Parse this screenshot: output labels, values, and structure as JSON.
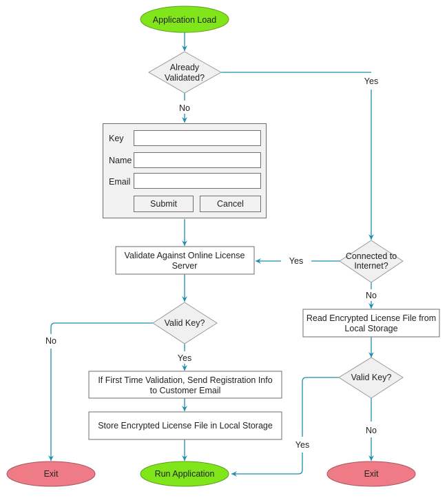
{
  "colors": {
    "connector": "#1b8db0",
    "start_fill": "#80e51a",
    "exit_fill": "#ee7b86",
    "decision_fill": "#f0f0f0",
    "box_stroke": "#6e6e6e"
  },
  "nodes": {
    "start": "Application Load",
    "already_validated": [
      "Already",
      "Validated?"
    ],
    "validate_online": [
      "Validate Against Online License",
      "Server"
    ],
    "valid_key_left": "Valid Key?",
    "send_registration": [
      "If First Time Validation, Send Registration Info",
      "to Customer Email"
    ],
    "store_license": "Store Encrypted License File in Local Storage",
    "exit_left": "Exit",
    "run_application": "Run Application",
    "connected_internet": [
      "Connected to",
      "Internet?"
    ],
    "read_license": [
      "Read Encrypted License File from",
      "Local Storage"
    ],
    "valid_key_right": "Valid Key?",
    "exit_right": "Exit"
  },
  "edge_labels": {
    "already_no": "No",
    "already_yes": "Yes",
    "connected_yes": "Yes",
    "connected_no": "No",
    "valid_left_no": "No",
    "valid_left_yes": "Yes",
    "valid_right_yes": "Yes",
    "valid_right_no": "No"
  },
  "form": {
    "key_label": "Key",
    "name_label": "Name",
    "email_label": "Email",
    "key_value": "",
    "name_value": "",
    "email_value": "",
    "submit_label": "Submit",
    "cancel_label": "Cancel"
  }
}
